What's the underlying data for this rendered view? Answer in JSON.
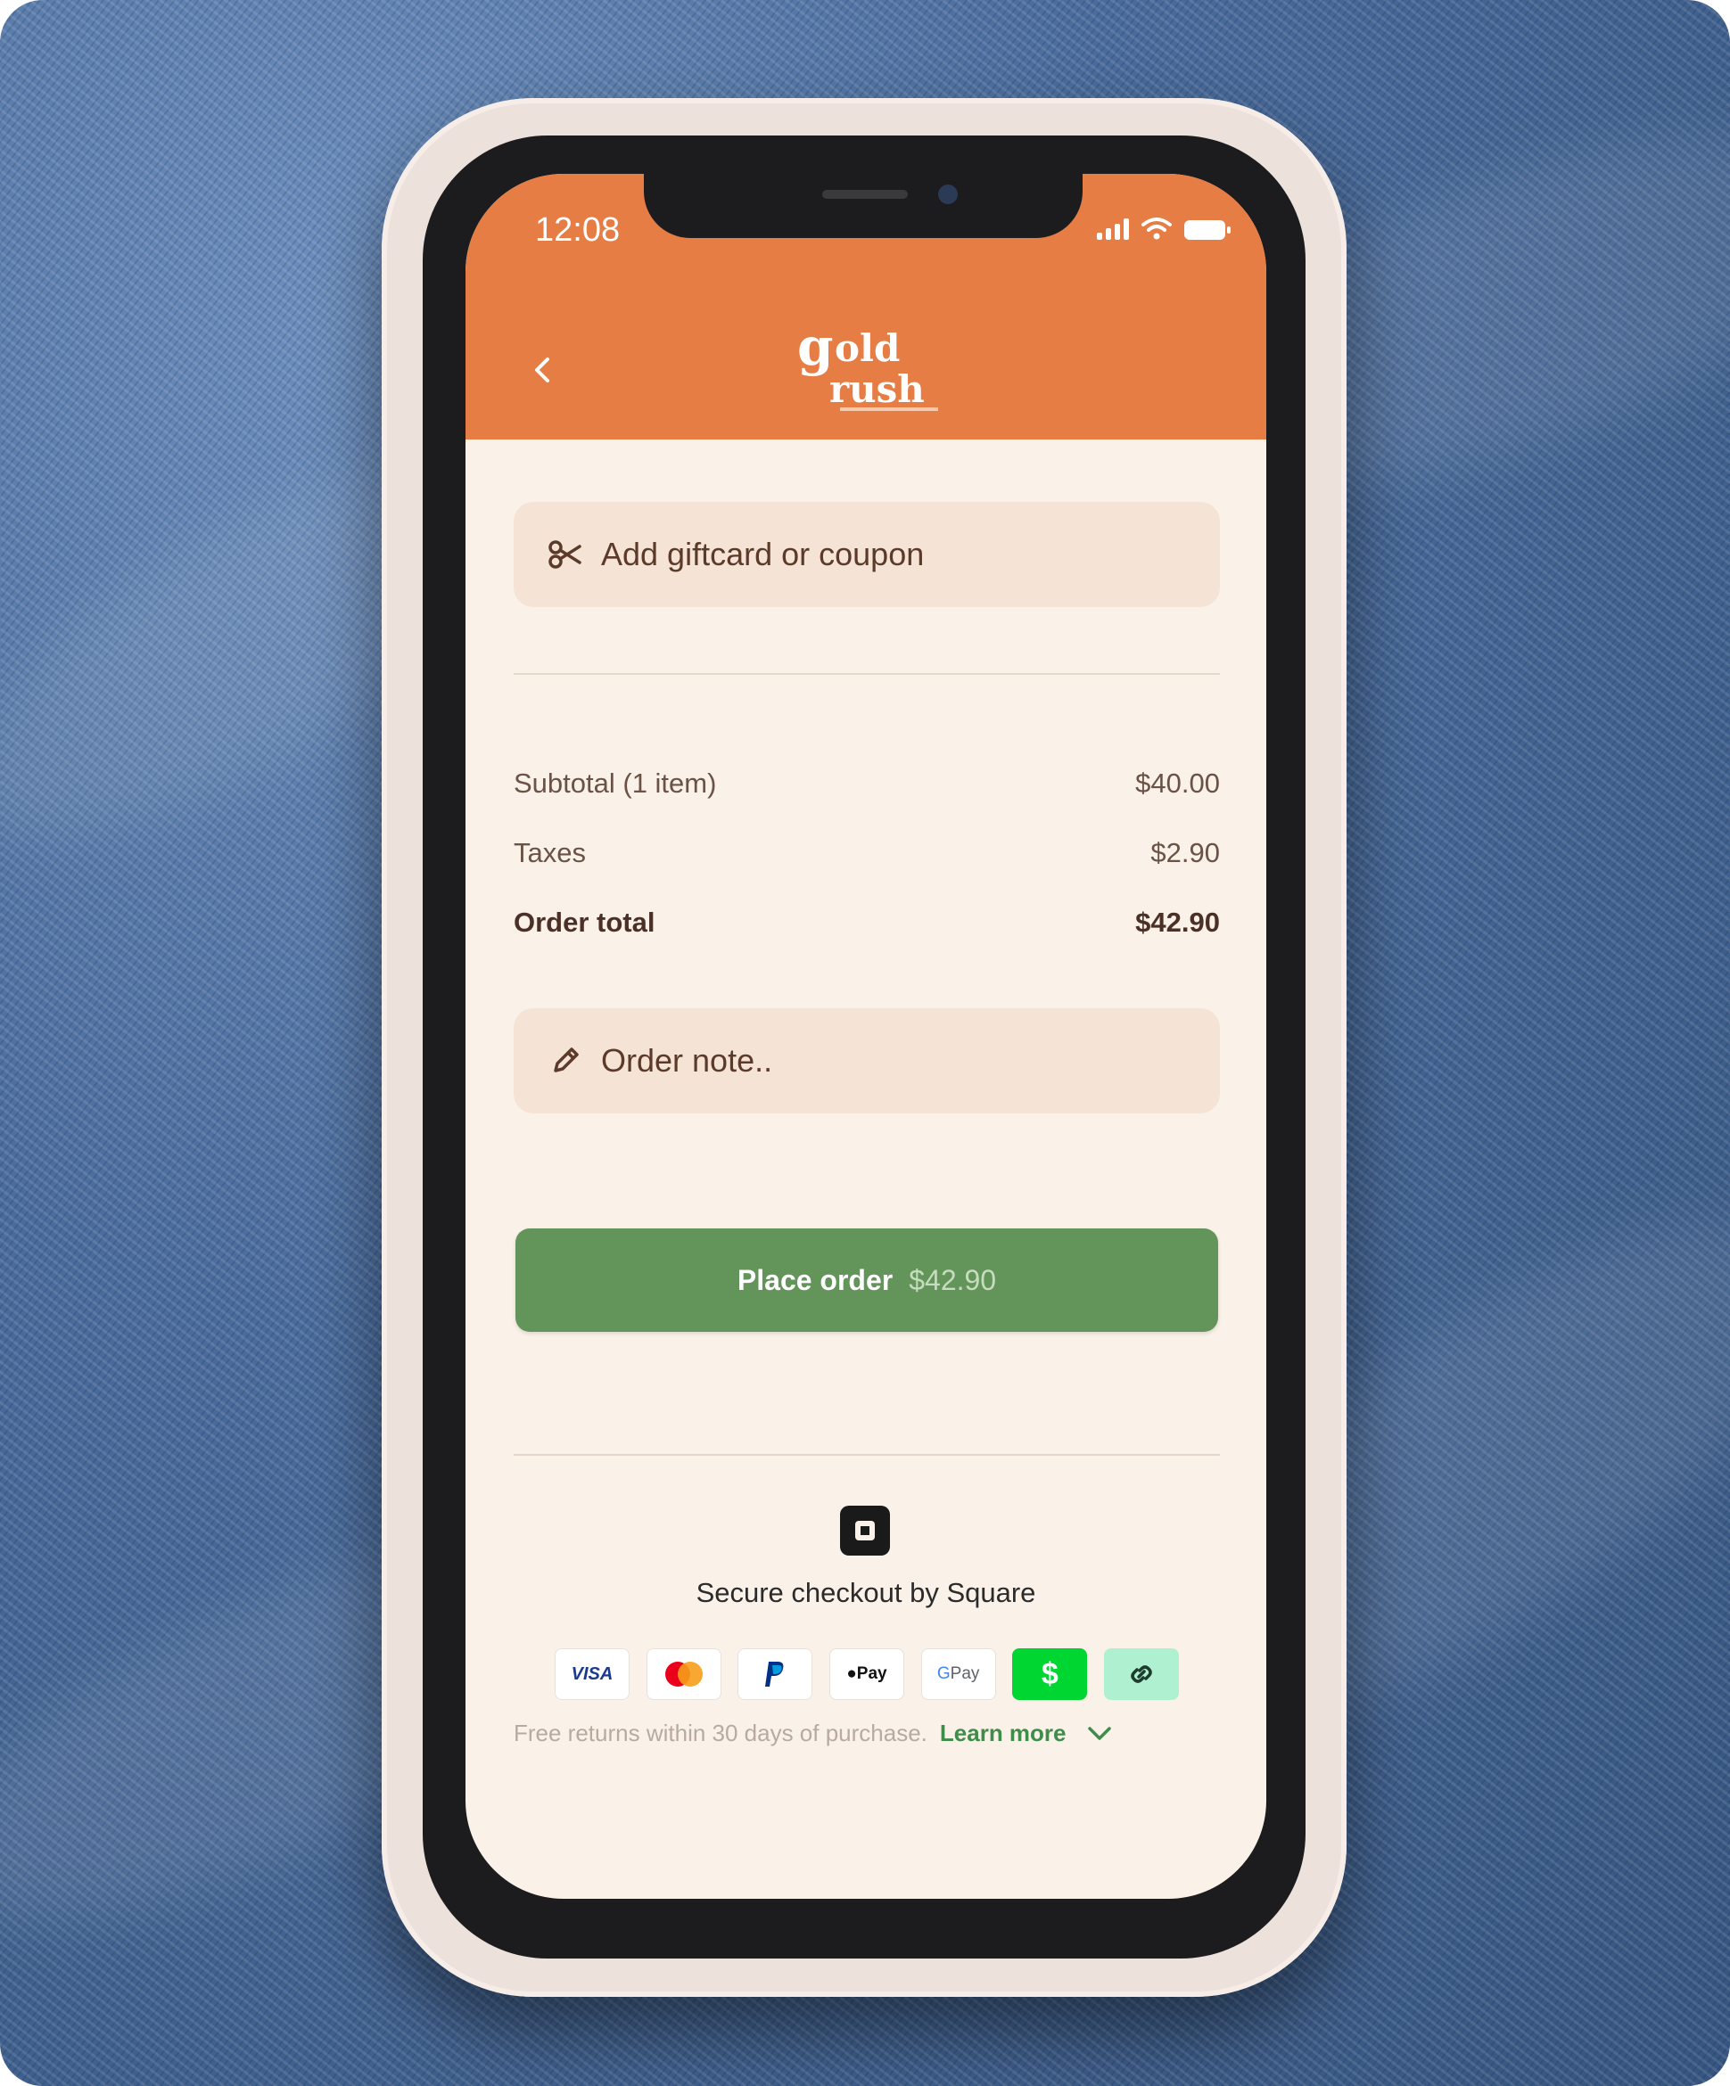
{
  "status_bar": {
    "time": "12:08"
  },
  "header": {
    "logo_text_line1": "gold",
    "logo_text_line2": "rush"
  },
  "coupon": {
    "label": "Add giftcard or coupon"
  },
  "summary": {
    "rows": [
      {
        "label": "Subtotal (1 item)",
        "value": "$40.00"
      },
      {
        "label": "Taxes",
        "value": "$2.90"
      },
      {
        "label": "Order total",
        "value": "$42.90"
      }
    ]
  },
  "order_note": {
    "placeholder": "Order note.."
  },
  "place_order": {
    "label": "Place order",
    "amount": "$42.90"
  },
  "footer": {
    "secure_text": "Secure checkout by Square",
    "payment_methods": [
      "VISA",
      "mastercard",
      "PayPal",
      "Apple Pay",
      "G Pay",
      "Cash App",
      "link"
    ],
    "returns_text": "Free returns within 30 days of purchase.",
    "learn_more": "Learn more"
  },
  "colors": {
    "header": "#e67d45",
    "background": "#faf1e8",
    "pill": "#f5e4d6",
    "button": "#639459",
    "link": "#3f8d4b"
  }
}
